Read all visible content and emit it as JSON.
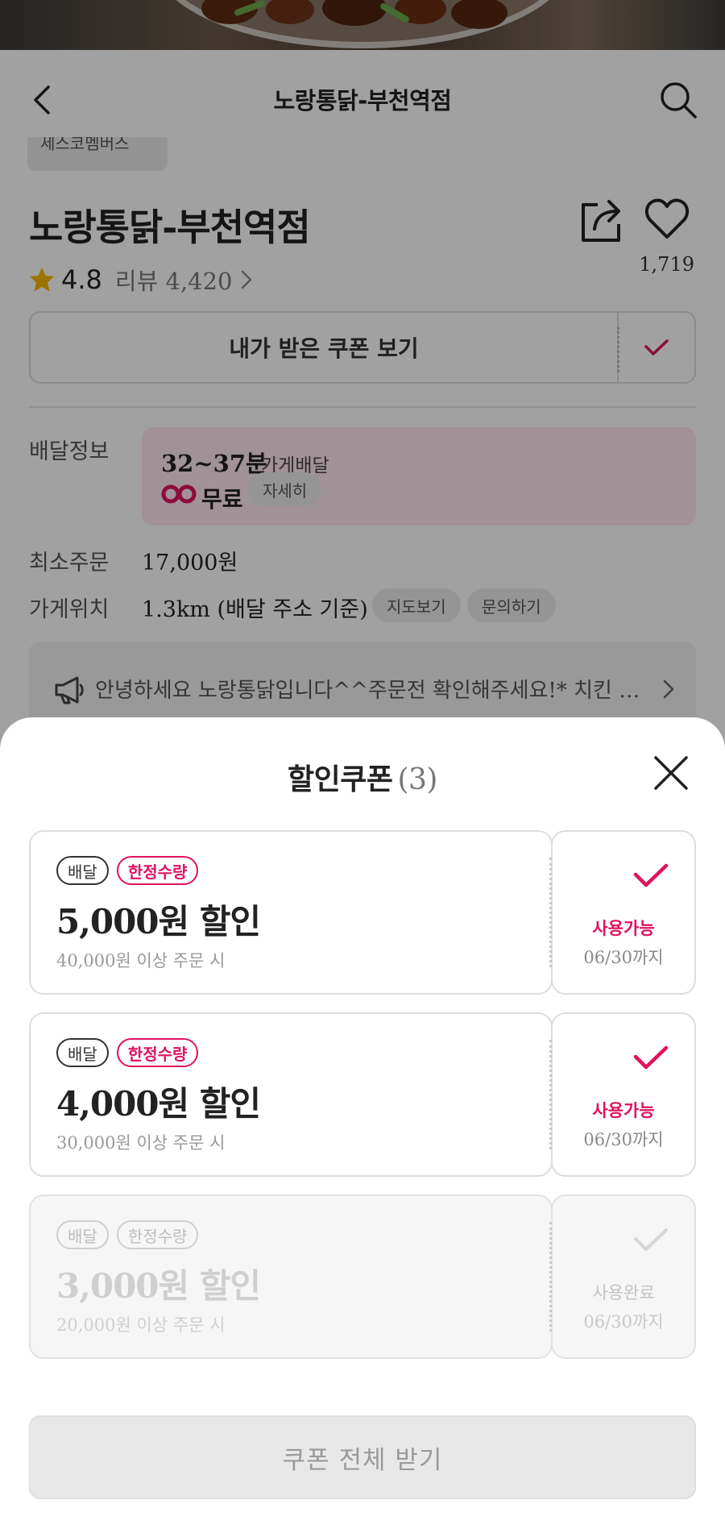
{
  "header": {
    "title": "노랑통닭-부천역점"
  },
  "store": {
    "tag_partial": "세스코멤버스",
    "name": "노랑통닭-부천역점",
    "likes": "1,719",
    "rating": "4.8",
    "review_label": "리뷰 4,420",
    "coupon_view_label": "내가 받은 쿠폰 보기"
  },
  "info": {
    "delivery_label": "배달정보",
    "delivery_time": "32~37분",
    "delivery_type": "가게배달",
    "delivery_fee": "무료",
    "detail_pill": "자세히",
    "min_order_label": "최소주문",
    "min_order_value": "17,000원",
    "location_label": "가게위치",
    "location_value": "1.3km (배달 주소 기준)",
    "map_pill": "지도보기",
    "inquiry_pill": "문의하기"
  },
  "notice": {
    "text": "안녕하세요 노랑통닭입니다^^주문전 확인해주세요!* 치킨 …"
  },
  "sheet": {
    "title": "할인쿠폰",
    "count": "(3)",
    "get_all_label": "쿠폰 전체 받기"
  },
  "coupons": [
    {
      "type_badge": "배달",
      "limit_badge": "한정수량",
      "amount": "5,000원 할인",
      "condition": "40,000원 이상 주문 시",
      "status": "사용가능",
      "expiry": "06/30까지"
    },
    {
      "type_badge": "배달",
      "limit_badge": "한정수량",
      "amount": "4,000원 할인",
      "condition": "30,000원 이상 주문 시",
      "status": "사용가능",
      "expiry": "06/30까지"
    },
    {
      "type_badge": "배달",
      "limit_badge": "한정수량",
      "amount": "3,000원 할인",
      "condition": "20,000원 이상 주문 시",
      "status": "사용완료",
      "expiry": "06/30까지"
    }
  ],
  "colors": {
    "accent": "#e0125f",
    "star": "#f5b800",
    "dim_overlay": "rgba(0,0,0,0.37)"
  },
  "icons": [
    "back-icon",
    "search-icon",
    "share-icon",
    "heart-icon",
    "star-icon",
    "chevron-right-icon",
    "check-icon",
    "megaphone-icon",
    "close-icon",
    "baemin-one-logo"
  ]
}
